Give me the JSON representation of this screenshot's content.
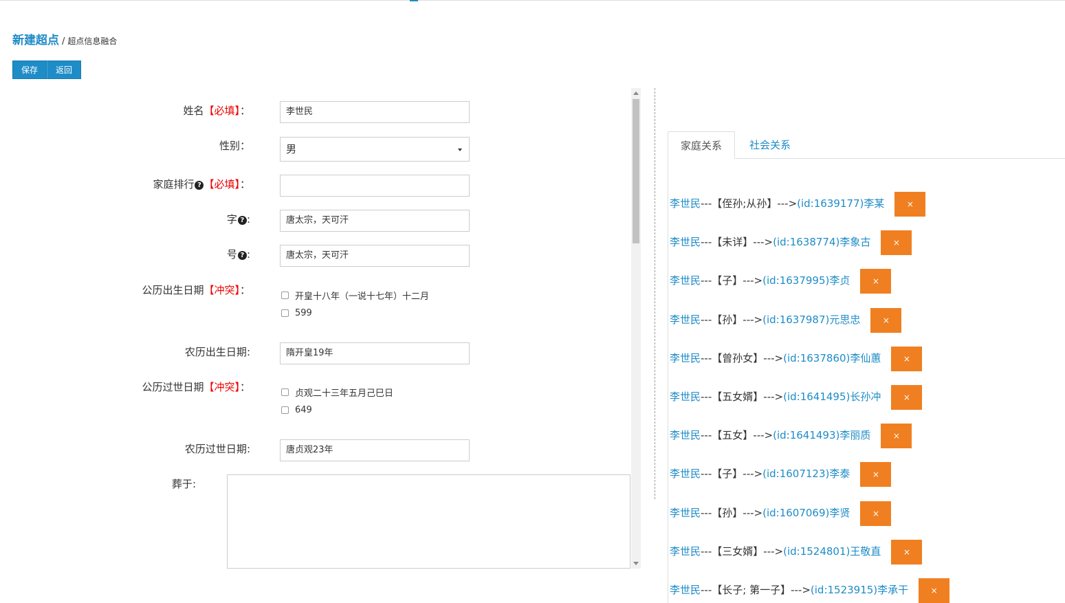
{
  "header": {
    "title": "新建超点",
    "separator": "/",
    "subtitle": "超点信息融合"
  },
  "toolbar": {
    "save_label": "保存",
    "back_label": "返回"
  },
  "form": {
    "name": {
      "label": "姓名",
      "required": "【必填】",
      "colon": "：",
      "value": "李世民"
    },
    "gender": {
      "label": "性别",
      "colon": "：",
      "value": "男"
    },
    "rank": {
      "label": "家庭排行",
      "required": "【必填】",
      "colon": "：",
      "value": ""
    },
    "courtesy": {
      "label": "字",
      "colon": ":",
      "value": "唐太宗，天可汗"
    },
    "alias": {
      "label": "号",
      "colon": ":",
      "value": "唐太宗，天可汗"
    },
    "birth_solar": {
      "label": "公历出生日期",
      "conflict": "【冲突】",
      "colon": "：",
      "options": [
        "开皇十八年（一说十七年）十二月",
        "599"
      ]
    },
    "birth_lunar": {
      "label": "农历出生日期",
      "colon": ":",
      "value": "隋开皇19年"
    },
    "death_solar": {
      "label": "公历过世日期",
      "conflict": "【冲突】",
      "colon": "：",
      "options": [
        "贞观二十三年五月己巳日",
        "649"
      ]
    },
    "death_lunar": {
      "label": "农历过世日期",
      "colon": ":",
      "value": "唐贞观23年"
    },
    "burial": {
      "label": "葬于",
      "colon": ":",
      "value": ""
    }
  },
  "tabs": {
    "family": "家庭关系",
    "social": "社会关系"
  },
  "relations": [
    {
      "self": "李世民",
      "arrow1": "---",
      "type": "【侄孙;从孙】",
      "arrow2": "--->",
      "target": "(id:1639177)李某",
      "delete": "×"
    },
    {
      "self": "李世民",
      "arrow1": "---",
      "type": "【未详】",
      "arrow2": "--->",
      "target": "(id:1638774)李象古",
      "delete": "×"
    },
    {
      "self": "李世民",
      "arrow1": "---",
      "type": "【子】",
      "arrow2": "--->",
      "target": "(id:1637995)李贞",
      "delete": "×"
    },
    {
      "self": "李世民",
      "arrow1": "---",
      "type": "【孙】",
      "arrow2": "--->",
      "target": "(id:1637987)元思忠",
      "delete": "×"
    },
    {
      "self": "李世民",
      "arrow1": "---",
      "type": "【曾孙女】",
      "arrow2": "--->",
      "target": "(id:1637860)李仙蕙",
      "delete": "×"
    },
    {
      "self": "李世民",
      "arrow1": "---",
      "type": "【五女婿】",
      "arrow2": "--->",
      "target": "(id:1641495)长孙冲",
      "delete": "×"
    },
    {
      "self": "李世民",
      "arrow1": "---",
      "type": "【五女】",
      "arrow2": "--->",
      "target": "(id:1641493)李丽质",
      "delete": "×"
    },
    {
      "self": "李世民",
      "arrow1": "---",
      "type": "【子】",
      "arrow2": "--->",
      "target": "(id:1607123)李泰",
      "delete": "×"
    },
    {
      "self": "李世民",
      "arrow1": "---",
      "type": "【孙】",
      "arrow2": "--->",
      "target": "(id:1607069)李贤",
      "delete": "×"
    },
    {
      "self": "李世民",
      "arrow1": "---",
      "type": "【三女婿】",
      "arrow2": "--->",
      "target": "(id:1524801)王敬直",
      "delete": "×"
    },
    {
      "self": "李世民",
      "arrow1": "---",
      "type": "【长子; 第一子】",
      "arrow2": "--->",
      "target": "(id:1523915)李承干",
      "delete": "×"
    }
  ],
  "icons": {
    "help": "question-circle-icon",
    "delete": "close-icon"
  },
  "colors": {
    "accent": "#1e8cc7",
    "required": "#ee0000",
    "delete_button": "#f07f21"
  }
}
